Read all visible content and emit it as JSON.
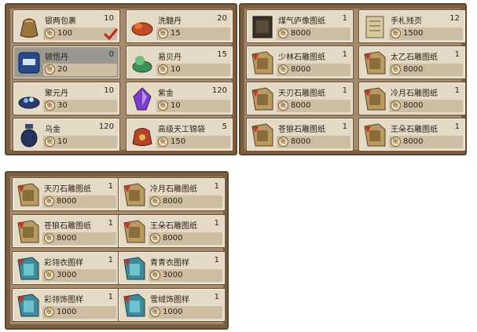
{
  "currency_glyph": "账",
  "panels": [
    {
      "id": "panel-top-left",
      "items": [
        {
          "name": "银两包裹",
          "qty": "10",
          "price": "100",
          "icon": "money-bag-icon",
          "selected": false,
          "checked": true
        },
        {
          "name": "洗髓丹",
          "qty": "20",
          "price": "15",
          "icon": "red-herb-icon",
          "selected": false,
          "checked": false
        },
        {
          "name": "顿悟丹",
          "qty": "0",
          "price": "20",
          "icon": "blue-scroll-icon",
          "selected": true,
          "checked": false
        },
        {
          "name": "易贝丹",
          "qty": "15",
          "price": "10",
          "icon": "green-herb-icon",
          "selected": false,
          "checked": false
        },
        {
          "name": "聚元丹",
          "qty": "10",
          "price": "30",
          "icon": "gem-bowl-icon",
          "selected": false,
          "checked": false
        },
        {
          "name": "紫金",
          "qty": "120",
          "price": "10",
          "icon": "purple-crystal-icon",
          "selected": false,
          "checked": false
        },
        {
          "name": "乌金",
          "qty": "120",
          "price": "10",
          "icon": "dark-jar-icon",
          "selected": false,
          "checked": false
        },
        {
          "name": "高级天工锦袋",
          "qty": "5",
          "price": "150",
          "icon": "brocade-pouch-icon",
          "selected": false,
          "checked": false
        }
      ]
    },
    {
      "id": "panel-top-right",
      "items": [
        {
          "name": "煤气庐像图纸",
          "qty": "1",
          "price": "8000",
          "icon": "dark-book-icon",
          "selected": false,
          "checked": false
        },
        {
          "name": "手札残页",
          "qty": "12",
          "price": "1500",
          "icon": "manuscript-icon",
          "selected": false,
          "checked": false
        },
        {
          "name": "少林石雕图纸",
          "qty": "1",
          "price": "8000",
          "icon": "tan-book-icon",
          "selected": false,
          "checked": false
        },
        {
          "name": "太乙石雕图纸",
          "qty": "1",
          "price": "8000",
          "icon": "tan-book-icon",
          "selected": false,
          "checked": false
        },
        {
          "name": "天刃石雕图纸",
          "qty": "1",
          "price": "8000",
          "icon": "tan-book-icon",
          "selected": false,
          "checked": false
        },
        {
          "name": "冷月石雕图纸",
          "qty": "1",
          "price": "8000",
          "icon": "tan-book-icon",
          "selected": false,
          "checked": false
        },
        {
          "name": "苍狼石雕图纸",
          "qty": "1",
          "price": "8000",
          "icon": "tan-book-icon",
          "selected": false,
          "checked": false
        },
        {
          "name": "王朵石雕图纸",
          "qty": "1",
          "price": "8000",
          "icon": "tan-book-icon",
          "selected": false,
          "checked": false
        }
      ]
    },
    {
      "id": "panel-bottom-left",
      "items": [
        {
          "name": "天刃石雕图纸",
          "qty": "1",
          "price": "8000",
          "icon": "tan-book-icon",
          "selected": false,
          "checked": false
        },
        {
          "name": "冷月石雕图纸",
          "qty": "1",
          "price": "8000",
          "icon": "tan-book-icon",
          "selected": false,
          "checked": false
        },
        {
          "name": "苍狼石雕图纸",
          "qty": "1",
          "price": "8000",
          "icon": "tan-book-icon",
          "selected": false,
          "checked": false
        },
        {
          "name": "王朵石雕图纸",
          "qty": "1",
          "price": "8000",
          "icon": "tan-book-icon",
          "selected": false,
          "checked": false
        },
        {
          "name": "彩翎衣图样",
          "qty": "1",
          "price": "3000",
          "icon": "teal-book-icon",
          "selected": false,
          "checked": false
        },
        {
          "name": "青青衣图样",
          "qty": "1",
          "price": "3000",
          "icon": "teal-book-icon",
          "selected": false,
          "checked": false
        },
        {
          "name": "彩翎饰图样",
          "qty": "1",
          "price": "1000",
          "icon": "teal-book-icon",
          "selected": false,
          "checked": false
        },
        {
          "name": "雪绒饰图样",
          "qty": "1",
          "price": "1000",
          "icon": "teal-book-icon",
          "selected": false,
          "checked": false
        }
      ]
    }
  ]
}
